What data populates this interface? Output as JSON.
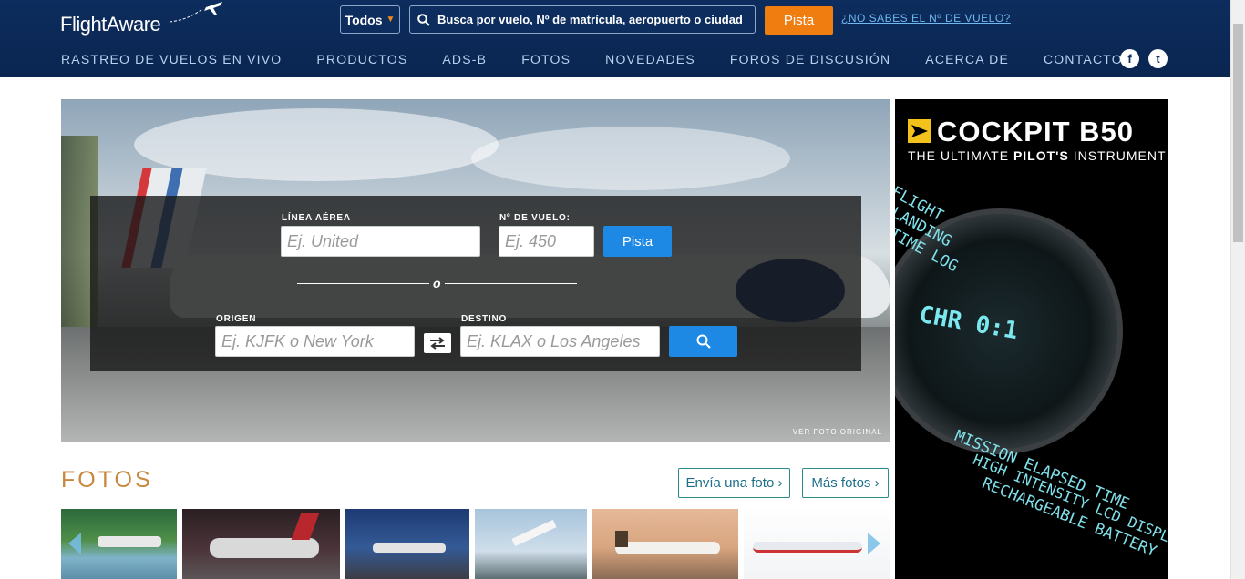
{
  "header": {
    "logo": "FlightAware",
    "search_scope": "Todos",
    "search_placeholder": "Busca por vuelo, Nº de matrícula, aeropuerto o ciudad",
    "search_button": "Pista",
    "help_link": "¿NO SABES EL Nº DE VUELO?",
    "nav": [
      "RASTREO DE VUELOS EN VIVO",
      "PRODUCTOS",
      "ADS-B",
      "FOTOS",
      "NOVEDADES",
      "FOROS DE DISCUSIÓN",
      "ACERCA DE",
      "CONTACTO"
    ],
    "social": [
      "facebook-icon",
      "twitter-icon"
    ]
  },
  "hero": {
    "airline_label": "LÍNEA AÉREA",
    "airline_placeholder": "Ej. United",
    "flight_label": "Nº DE VUELO:",
    "flight_placeholder": "Ej. 450",
    "track_button": "Pista",
    "or_text": "o",
    "origin_label": "ORIGEN",
    "origin_placeholder": "Ej. KJFK o New York",
    "destination_label": "DESTINO",
    "destination_placeholder": "Ej. KLAX o Los Angeles",
    "view_original": "VER FOTO ORIGINAL"
  },
  "photos": {
    "title": "FOTOS",
    "submit_button": "Envía una foto ›",
    "more_button": "Más fotos ›"
  },
  "ad": {
    "title": "COCKPIT B50",
    "subtitle_pre": "THE ULTIMATE ",
    "subtitle_bold": "PILOT'S",
    "subtitle_post": " INSTRUMENT",
    "watch_display": "CHR 0:1",
    "side_text_1": "FLIGHT",
    "side_text_2": "LANDING",
    "side_text_3": "TIME LOG",
    "bottom_text_1": "MISSION ELAPSED TIME",
    "bottom_text_2": "HIGH INTENSITY LCD DISPLAY",
    "bottom_text_3": "RECHARGEABLE BATTERY"
  },
  "colors": {
    "header_bg": "#0d2d5e",
    "accent_orange": "#f07d10",
    "accent_blue": "#1e88e5",
    "fotos_title": "#c8883d"
  }
}
